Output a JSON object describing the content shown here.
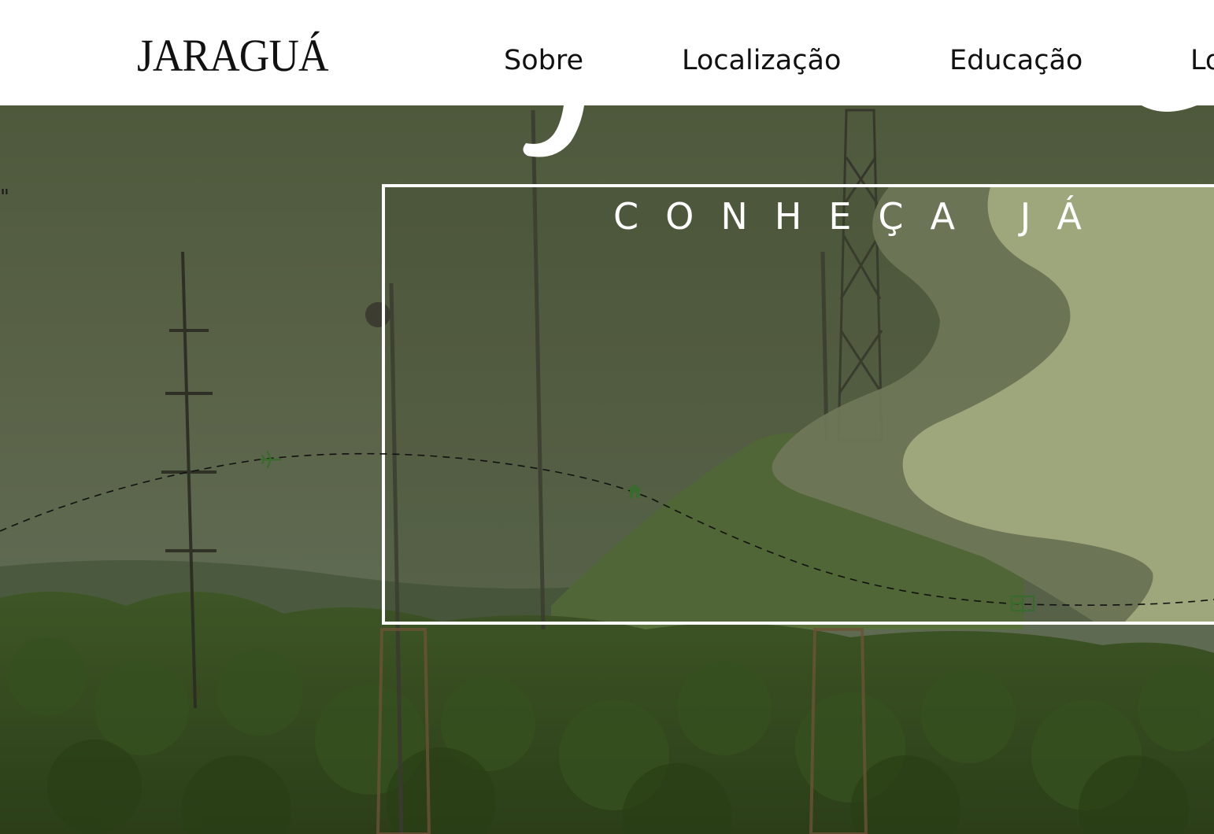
{
  "header": {
    "logo": "JARAGUÁ",
    "nav": [
      {
        "label": "Sobre"
      },
      {
        "label": "Localização"
      },
      {
        "label": "Educação"
      },
      {
        "label": "Lo"
      }
    ]
  },
  "hero": {
    "quote": "\"",
    "card_title": "CONHEÇA JÁ"
  },
  "path": {
    "icons": [
      "airplane-icon",
      "home-icon",
      "book-icon"
    ]
  },
  "colors": {
    "header_bg": "#ffffff",
    "overlay": "#55613f",
    "wave_dark": "#6e7657",
    "wave_light": "#9ea67c",
    "icon_green": "#3a6b2e"
  }
}
